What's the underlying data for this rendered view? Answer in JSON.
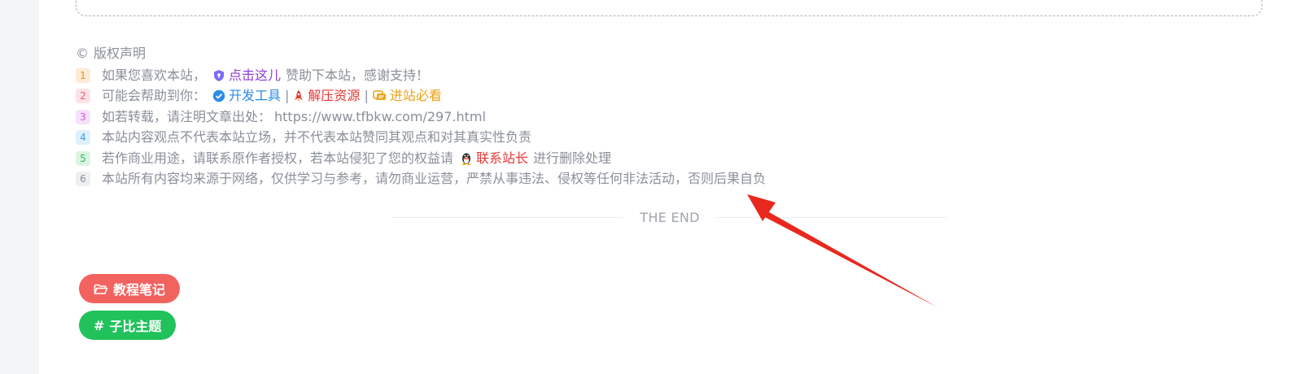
{
  "copyright": {
    "symbol": "©",
    "title": "版权声明",
    "rows": [
      {
        "num": "1",
        "pre": "如果您喜欢本站，",
        "link": "点击这儿",
        "post": "赞助下本站，感谢支持！"
      },
      {
        "num": "2",
        "pre": "可能会帮助到你：",
        "links": [
          "开发工具",
          "解压资源",
          "进站必看"
        ],
        "sep": "|"
      },
      {
        "num": "3",
        "pre": "如若转载，请注明文章出处：",
        "url": "https://www.tfbkw.com/297.html"
      },
      {
        "num": "4",
        "text": "本站内容观点不代表本站立场，并不代表本站赞同其观点和对其真实性负责"
      },
      {
        "num": "5",
        "pre": "若作商业用途，请联系原作者授权，若本站侵犯了您的权益请",
        "link": "联系站长",
        "post": "进行删除处理"
      },
      {
        "num": "6",
        "text": "本站所有内容均来源于网络，仅供学习与参考，请勿商业运营，严禁从事违法、侵权等任何非法活动，否则后果自负"
      }
    ]
  },
  "end_text": "THE END",
  "tags": [
    {
      "label": "教程笔记",
      "icon": "folder-icon",
      "color": "#f26360"
    },
    {
      "label": "子比主题",
      "prefix": "#",
      "color": "#21c15b"
    }
  ],
  "icons": {
    "row1": "shield-icon",
    "row2_a": "verified-badge-icon",
    "row2_b": "rocket-icon",
    "row2_c": "chat-icon",
    "row5": "qq-penguin-icon"
  }
}
